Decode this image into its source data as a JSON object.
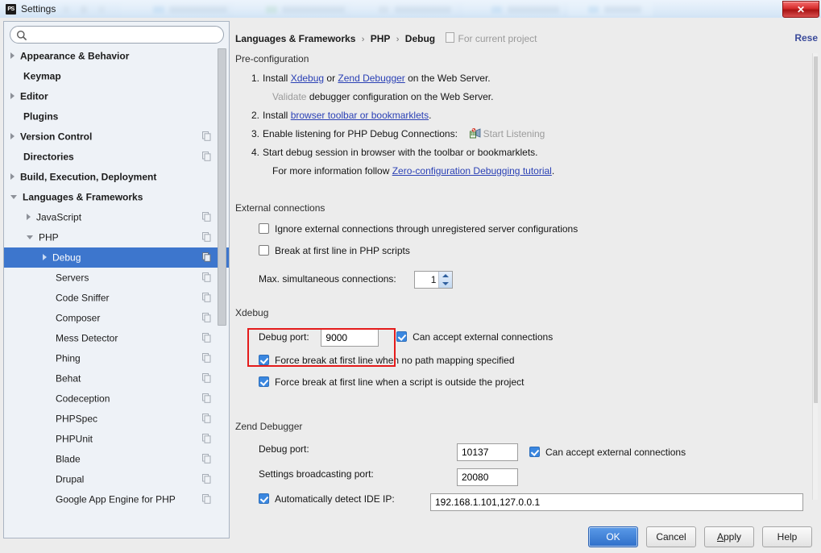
{
  "window": {
    "title": "Settings",
    "app_icon": "ps-icon",
    "close_label": "✕"
  },
  "sidebar": {
    "search": {
      "value": "",
      "placeholder": ""
    },
    "items": [
      {
        "label": "Appearance & Behavior",
        "indent": 0,
        "bold": true,
        "arrow": "right",
        "copy": false,
        "selected": false
      },
      {
        "label": "Keymap",
        "indent": 0,
        "bold": true,
        "arrow": "none",
        "copy": false,
        "selected": false
      },
      {
        "label": "Editor",
        "indent": 0,
        "bold": true,
        "arrow": "right",
        "copy": false,
        "selected": false
      },
      {
        "label": "Plugins",
        "indent": 0,
        "bold": true,
        "arrow": "none",
        "copy": false,
        "selected": false
      },
      {
        "label": "Version Control",
        "indent": 0,
        "bold": true,
        "arrow": "right",
        "copy": true,
        "selected": false
      },
      {
        "label": "Directories",
        "indent": 0,
        "bold": true,
        "arrow": "none",
        "copy": true,
        "selected": false
      },
      {
        "label": "Build, Execution, Deployment",
        "indent": 0,
        "bold": true,
        "arrow": "right",
        "copy": false,
        "selected": false
      },
      {
        "label": "Languages & Frameworks",
        "indent": 0,
        "bold": true,
        "arrow": "down",
        "copy": false,
        "selected": false
      },
      {
        "label": "JavaScript",
        "indent": 1,
        "bold": false,
        "arrow": "right",
        "copy": true,
        "selected": false
      },
      {
        "label": "PHP",
        "indent": 1,
        "bold": false,
        "arrow": "down",
        "copy": true,
        "selected": false
      },
      {
        "label": "Debug",
        "indent": 2,
        "bold": false,
        "arrow": "right",
        "copy": true,
        "selected": true
      },
      {
        "label": "Servers",
        "indent": 2,
        "bold": false,
        "arrow": "none",
        "copy": true,
        "selected": false
      },
      {
        "label": "Code Sniffer",
        "indent": 2,
        "bold": false,
        "arrow": "none",
        "copy": true,
        "selected": false
      },
      {
        "label": "Composer",
        "indent": 2,
        "bold": false,
        "arrow": "none",
        "copy": true,
        "selected": false
      },
      {
        "label": "Mess Detector",
        "indent": 2,
        "bold": false,
        "arrow": "none",
        "copy": true,
        "selected": false
      },
      {
        "label": "Phing",
        "indent": 2,
        "bold": false,
        "arrow": "none",
        "copy": true,
        "selected": false
      },
      {
        "label": "Behat",
        "indent": 2,
        "bold": false,
        "arrow": "none",
        "copy": true,
        "selected": false
      },
      {
        "label": "Codeception",
        "indent": 2,
        "bold": false,
        "arrow": "none",
        "copy": true,
        "selected": false
      },
      {
        "label": "PHPSpec",
        "indent": 2,
        "bold": false,
        "arrow": "none",
        "copy": true,
        "selected": false
      },
      {
        "label": "PHPUnit",
        "indent": 2,
        "bold": false,
        "arrow": "none",
        "copy": true,
        "selected": false
      },
      {
        "label": "Blade",
        "indent": 2,
        "bold": false,
        "arrow": "none",
        "copy": true,
        "selected": false
      },
      {
        "label": "Drupal",
        "indent": 2,
        "bold": false,
        "arrow": "none",
        "copy": true,
        "selected": false
      },
      {
        "label": "Google App Engine for PHP",
        "indent": 2,
        "bold": false,
        "arrow": "none",
        "copy": true,
        "selected": false
      }
    ]
  },
  "breadcrumb": {
    "parts": [
      "Languages & Frameworks",
      "PHP",
      "Debug"
    ],
    "separator": "›",
    "scope": "For current project",
    "reset": "Reset"
  },
  "preconfig": {
    "title": "Pre-configuration",
    "step1": {
      "num": "1.",
      "prefix": "Install ",
      "link1": "Xdebug",
      "mid": " or ",
      "link2": "Zend Debugger",
      "suffix": " on the Web Server."
    },
    "validate": {
      "link": "Validate",
      "text": " debugger configuration on the Web Server."
    },
    "step2": {
      "num": "2.",
      "prefix": "Install ",
      "link": "browser toolbar or bookmarklets",
      "suffix": "."
    },
    "step3": {
      "num": "3.",
      "text": "Enable listening for PHP Debug Connections:",
      "action": "Start Listening",
      "icon": "listen-icon"
    },
    "step4": {
      "num": "4.",
      "text": "Start debug session in browser with the toolbar or bookmarklets."
    },
    "moreinfo": {
      "prefix": "For more information follow ",
      "link": "Zero-configuration Debugging tutorial",
      "suffix": "."
    }
  },
  "external": {
    "title": "External connections",
    "ignore": {
      "label": "Ignore external connections through unregistered server configurations",
      "checked": false
    },
    "breakfirst": {
      "label": "Break at first line in PHP scripts",
      "checked": false
    },
    "maxconn": {
      "label": "Max. simultaneous connections:",
      "value": "1"
    }
  },
  "xdebug": {
    "title": "Xdebug",
    "debug_port": {
      "label": "Debug port:",
      "value": "9000"
    },
    "can_accept": {
      "label": "Can accept external connections",
      "checked": true
    },
    "force_nomap": {
      "label": "Force break at first line when no path mapping specified",
      "checked": true
    },
    "force_outside": {
      "label": "Force break at first line when a script is outside the project",
      "checked": true
    },
    "highlight_color": "#e41b1b"
  },
  "zend": {
    "title": "Zend Debugger",
    "debug_port": {
      "label": "Debug port:",
      "value": "10137"
    },
    "can_accept": {
      "label": "Can accept external connections",
      "checked": true
    },
    "broadcast_port": {
      "label": "Settings broadcasting port:",
      "value": "20080"
    },
    "autodetect": {
      "label": "Automatically detect IDE IP:",
      "checked": true,
      "value": "192.168.1.101,127.0.0.1"
    }
  },
  "buttons": {
    "ok": "OK",
    "cancel": "Cancel",
    "apply_pre": "A",
    "apply_post": "pply",
    "help": "Help"
  }
}
